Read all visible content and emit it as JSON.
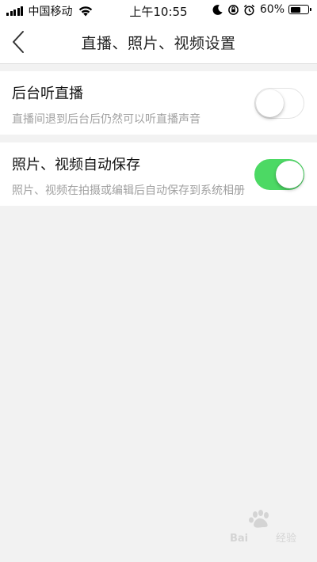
{
  "status_bar": {
    "carrier": "中国移动",
    "time": "上午10:55",
    "battery_percent": "60%",
    "battery_level": 0.6,
    "icons": [
      "signal-icon",
      "wifi-icon",
      "moon-icon",
      "orientation-lock-icon",
      "alarm-icon",
      "battery-icon"
    ]
  },
  "nav": {
    "title": "直播、照片、视频设置",
    "back_icon": "chevron-left-icon"
  },
  "settings": [
    {
      "title": "后台听直播",
      "description": "直播间退到后台后仍然可以听直播声音",
      "enabled": false
    },
    {
      "title": "照片、视频自动保存",
      "description": "照片、视频在拍摄或编辑后自动保存到系统相册",
      "enabled": true
    }
  ],
  "colors": {
    "toggle_on": "#4cd964",
    "toggle_off_border": "#e2e2e2",
    "background": "#f2f2f2"
  }
}
